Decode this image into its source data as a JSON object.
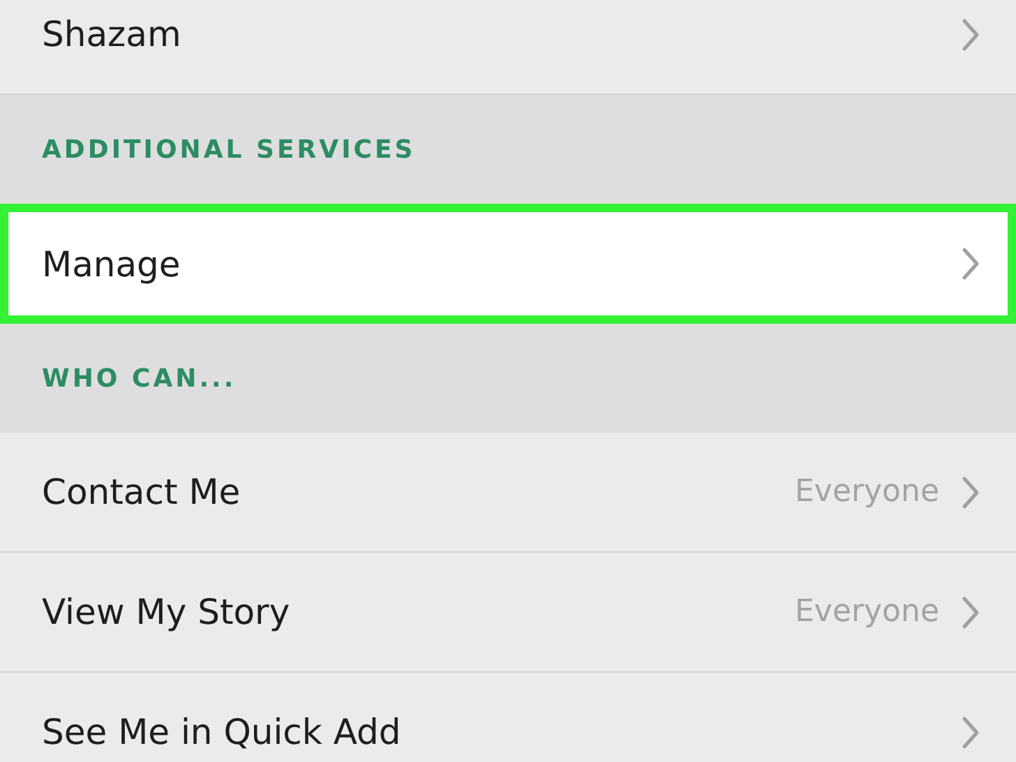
{
  "rows": [
    {
      "kind": "row",
      "label": "Shazam",
      "selected": false
    },
    {
      "kind": "header",
      "label": "ADDITIONAL SERVICES"
    },
    {
      "kind": "row",
      "label": "Manage",
      "selected": true
    },
    {
      "kind": "header",
      "label": "WHO CAN..."
    },
    {
      "kind": "row",
      "label": "Contact Me",
      "value": "Everyone",
      "selected": false
    },
    {
      "kind": "row",
      "label": "View My Story",
      "value": "Everyone",
      "selected": false
    },
    {
      "kind": "row",
      "label": "See Me in Quick Add",
      "selected": false
    }
  ]
}
